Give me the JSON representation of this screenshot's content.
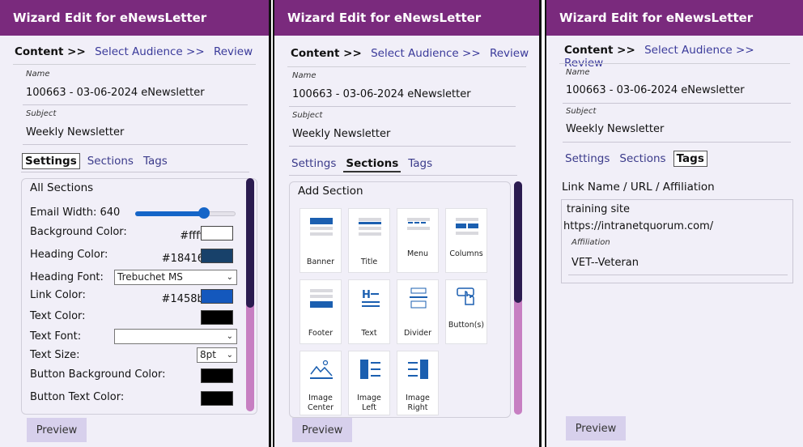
{
  "title": "Wizard Edit for eNewsLetter",
  "wizard_steps": [
    "Content >>",
    "Select Audience >>",
    "Review"
  ],
  "name_label": "Name",
  "name_value": "100663 - 03-06-2024 eNewsletter",
  "subject_label": "Subject",
  "subject_value": "Weekly Newsletter",
  "subtabs": [
    "Settings",
    "Sections",
    "Tags"
  ],
  "settings": {
    "group_title": "All Sections",
    "email_width_label": "Email Width: 640",
    "email_width_value": 640,
    "background_color_label": "Background Color:",
    "background_color": "#ffffff",
    "heading_color_label": "Heading Color:",
    "heading_color": "#18416a",
    "heading_font_label": "Heading Font:",
    "heading_font_value": "Trebuchet MS",
    "link_color_label": "Link Color:",
    "link_color": "#1458bd",
    "text_color_label": "Text Color:",
    "text_font_label": "Text Font:",
    "text_size_label": "Text Size:",
    "text_size_value": "8pt",
    "button_bg_label": "Button Background Color:",
    "button_text_label": "Button Text Color:"
  },
  "sections_panel": {
    "group_title": "Add Section",
    "tiles": [
      "Banner",
      "Title",
      "Menu",
      "Columns",
      "Footer",
      "Text",
      "Divider",
      "Button(s)",
      "Image Center",
      "Image Left",
      "Image Right"
    ]
  },
  "tags_panel": {
    "header": "Link Name / URL / Affiliation",
    "link_name": "training site",
    "url": "https://intranetquorum.com/",
    "affiliation_label": "Affiliation",
    "affiliation_value": "VET--Veteran"
  },
  "preview_label": "Preview",
  "colors": {
    "titlebar": "#7a2a7d",
    "panel_bg": "#f1eff8",
    "scroll_track": "#c77fc2",
    "scroll_thumb": "#2b1c50",
    "icon_blue": "#1b5fb0"
  }
}
